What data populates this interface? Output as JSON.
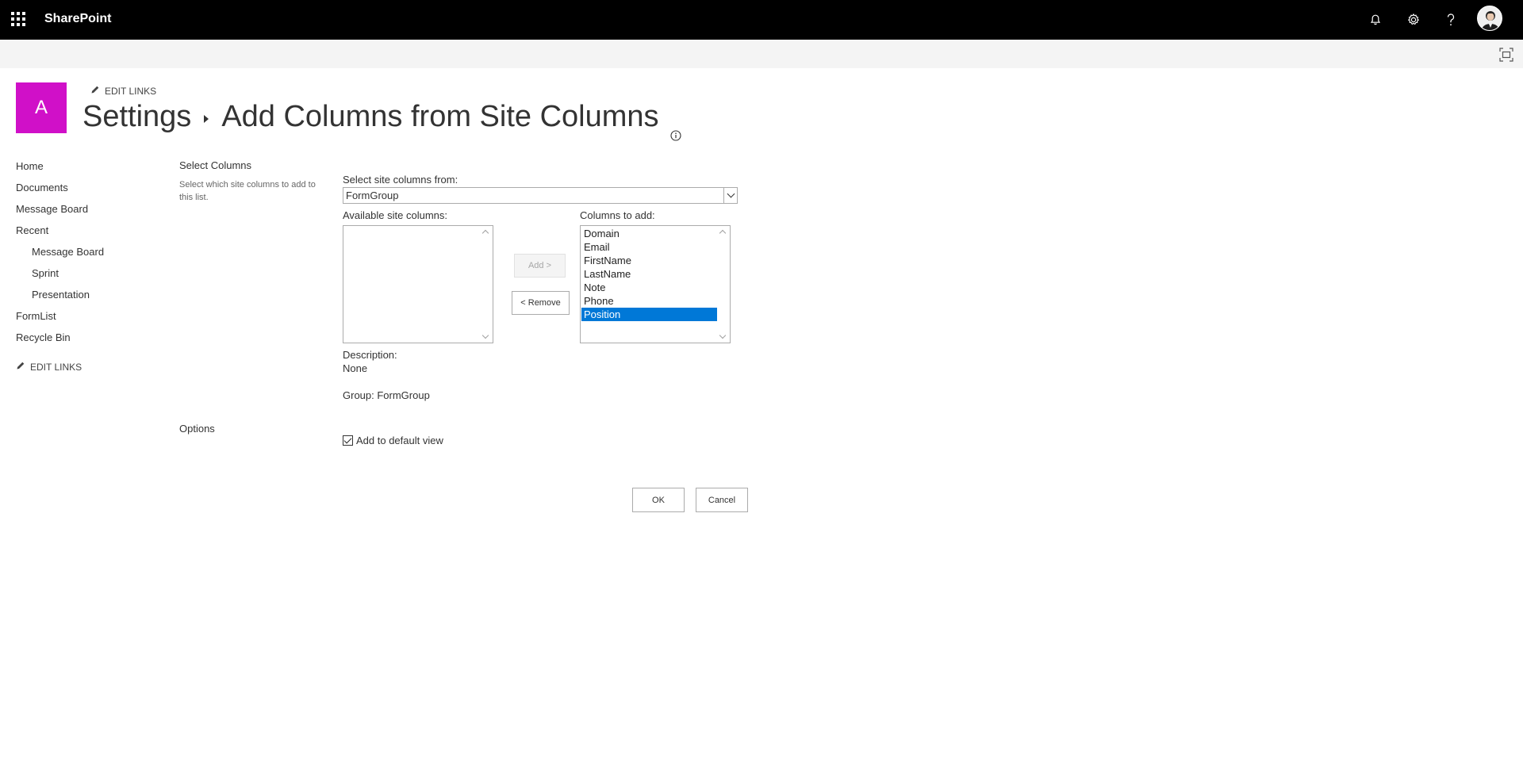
{
  "suitebar": {
    "app_name": "SharePoint",
    "icons": [
      "app-launcher-icon",
      "bell-icon",
      "gear-icon",
      "help-icon",
      "avatar"
    ]
  },
  "site": {
    "logo_letter": "A",
    "logo_color": "#d010c8",
    "top_edit_links": "EDIT LINKS"
  },
  "page": {
    "breadcrumb_root": "Settings",
    "title": "Add Columns from Site Columns"
  },
  "leftnav": {
    "items": [
      {
        "label": "Home"
      },
      {
        "label": "Documents"
      },
      {
        "label": "Message Board"
      },
      {
        "label": "Recent"
      },
      {
        "label": "Message Board"
      },
      {
        "label": "Sprint"
      },
      {
        "label": "Presentation"
      },
      {
        "label": "FormList"
      },
      {
        "label": "Recycle Bin"
      }
    ],
    "edit_links": "EDIT LINKS"
  },
  "form": {
    "select_columns_title": "Select Columns",
    "select_columns_desc": "Select which site columns to add to this list.",
    "select_from_label": "Select site columns from:",
    "select_from_value": "FormGroup",
    "available_label": "Available site columns:",
    "available_items": [],
    "add_button": "Add >",
    "remove_button": "< Remove",
    "columns_to_add_label": "Columns to add:",
    "columns_to_add": [
      "Domain",
      "Email",
      "FirstName",
      "LastName",
      "Note",
      "Phone",
      "Position"
    ],
    "selected_column": "Position",
    "description_label": "Description:",
    "description_value": "None",
    "group_text": "Group: FormGroup",
    "options_title": "Options",
    "add_to_default_view": "Add to default view",
    "add_to_default_view_checked": true,
    "ok_button": "OK",
    "cancel_button": "Cancel"
  },
  "colors": {
    "suitebar_bg": "#000000",
    "selection": "#0078d7"
  }
}
